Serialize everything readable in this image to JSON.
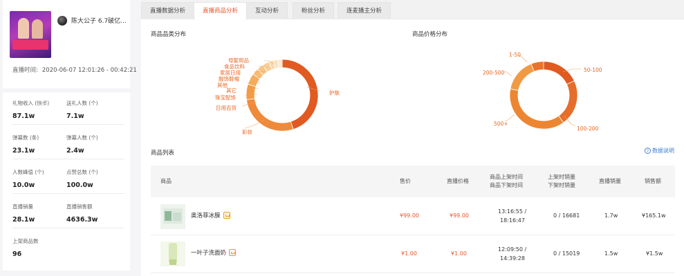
{
  "anchor": {
    "name": "陈大公子 6.7破亿...",
    "live_time_label": "直播时间:",
    "live_time_value": "2020-06-07 12:01:26 - 00:42:21"
  },
  "stats": [
    {
      "label": "礼物收入 (快币)",
      "value": "87.1w"
    },
    {
      "label": "送礼人数 (个)",
      "value": "7.1w"
    },
    {
      "label": "弹幕数 (条)",
      "value": "23.1w"
    },
    {
      "label": "弹幕人数 (个)",
      "value": "2.4w"
    },
    {
      "label": "人数峰值 (个)",
      "value": "10.0w"
    },
    {
      "label": "点赞总数 (个)",
      "value": "100.0w"
    },
    {
      "label": "直播销量",
      "value": "28.1w"
    },
    {
      "label": "直播销售额",
      "value": "4636.3w"
    },
    {
      "label": "上架商品数",
      "value": "96"
    }
  ],
  "tabs": [
    "直播数据分析",
    "直播商品分析",
    "互动分析",
    "粉丝分析",
    "连麦播主分析"
  ],
  "active_tab": 1,
  "sections": {
    "category_title": "商品品类分布",
    "price_title": "商品价格分布",
    "list_title": "商品列表",
    "help": "数据说明"
  },
  "category_chart": {
    "type": "pie",
    "labels": [
      "护肤",
      "彩妆",
      "日用百货",
      "珠宝配饰",
      "其它",
      "其他",
      "服饰鞋帽",
      "家居日用",
      "食品饮料",
      "母婴用品"
    ],
    "values": [
      45,
      28,
      7,
      5,
      3,
      3,
      3,
      2,
      2,
      2
    ],
    "colors": [
      "#e05a22",
      "#ef8a3a",
      "#f29b45",
      "#f5ac5c",
      "#f7bb72",
      "#f8c585",
      "#f9cf98",
      "#fad8aa",
      "#fbe1bd",
      "#fce9cf"
    ]
  },
  "price_chart": {
    "type": "pie",
    "labels": [
      "50-100",
      "100-200",
      "500+",
      "200-500",
      "1-50"
    ],
    "values": [
      18,
      22,
      38,
      16,
      6
    ],
    "colors": [
      "#e05a22",
      "#e56e2a",
      "#ec8633",
      "#f19a44",
      "#e9732d"
    ]
  },
  "table": {
    "headers": [
      "商品",
      "售价",
      "直播价格",
      "商品上架时间\n商品下架时间",
      "上架时销量\n下架时销量",
      "直播销量",
      "销售额"
    ],
    "rows": [
      {
        "name": "奥洛菲冰膜",
        "price": "¥99.00",
        "live_price": "¥99.00",
        "time_on": "13:16:55 /",
        "time_off": "18:16:47",
        "sales_change": "0 / 16681",
        "live_sales": "1.7w",
        "revenue": "¥165.1w"
      },
      {
        "name": "一叶子洗面奶",
        "price": "¥1.00",
        "live_price": "¥1.00",
        "time_on": "12:09:50 /",
        "time_off": "14:39:28",
        "sales_change": "0 / 15019",
        "live_sales": "1.5w",
        "revenue": "¥1.5w"
      }
    ]
  }
}
